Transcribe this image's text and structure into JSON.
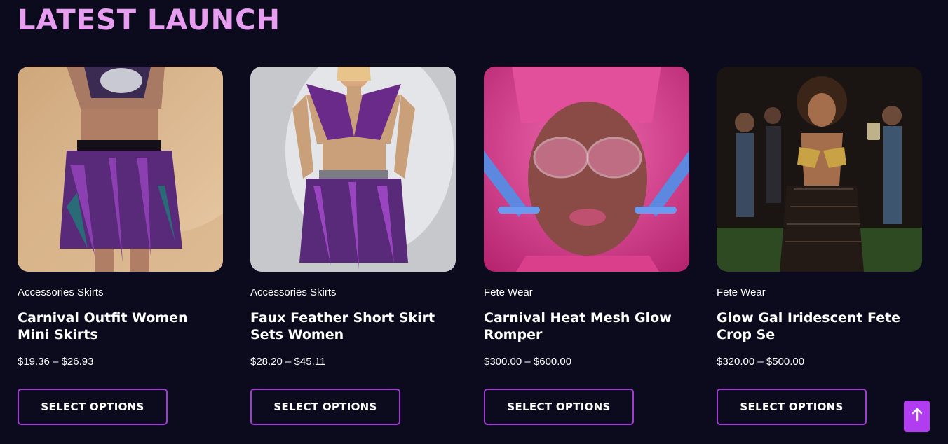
{
  "section": {
    "title": "LATEST LAUNCH"
  },
  "products": [
    {
      "category": "Accessories Skirts",
      "title": "Carnival Outfit Women Mini Skirts",
      "price": "$19.36 – $26.93",
      "button": "SELECT OPTIONS"
    },
    {
      "category": "Accessories Skirts",
      "title": "Faux Feather Short Skirt Sets Women",
      "price": "$28.20 – $45.11",
      "button": "SELECT OPTIONS"
    },
    {
      "category": "Fete Wear",
      "title": "Carnival Heat Mesh Glow Romper",
      "price": "$300.00 – $600.00",
      "button": "SELECT OPTIONS"
    },
    {
      "category": "Fete Wear",
      "title": "Glow Gal Iridescent Fete Crop Se",
      "price": "$320.00 – $500.00",
      "button": "SELECT OPTIONS"
    }
  ],
  "scroll_top": {
    "icon": "arrow-up-icon"
  },
  "colors": {
    "background": "#0c0a1d",
    "heading": "#e89ef0",
    "button_border": "#a23ad6",
    "scroll_button": "#b13cf0"
  }
}
